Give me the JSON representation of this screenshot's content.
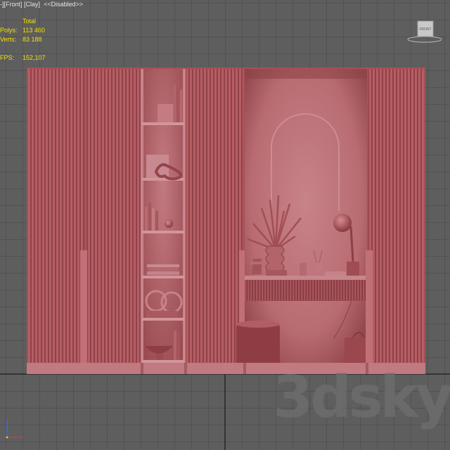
{
  "viewport": {
    "menu_label": "-]",
    "view_label": "[Front]",
    "shading_label": "[Clay]",
    "state_label": "<<Disabled>>"
  },
  "stats": {
    "total_label": "Total",
    "polys_label": "Polys:",
    "polys_value": "113 460",
    "verts_label": "Verts:",
    "verts_value": "83 188",
    "fps_label": "FPS:",
    "fps_value": "152,107"
  },
  "viewcube": {
    "label": "FRONT"
  },
  "watermark": {
    "text": "3dsky"
  },
  "colors": {
    "background": "#5e5e5e",
    "grid": "#4a4a4a",
    "grid_major": "#2e2e2e",
    "clay": "#b05a60",
    "clay_light": "#c9868a",
    "clay_dark": "#7e3b40",
    "stats_text": "#f3e200"
  }
}
